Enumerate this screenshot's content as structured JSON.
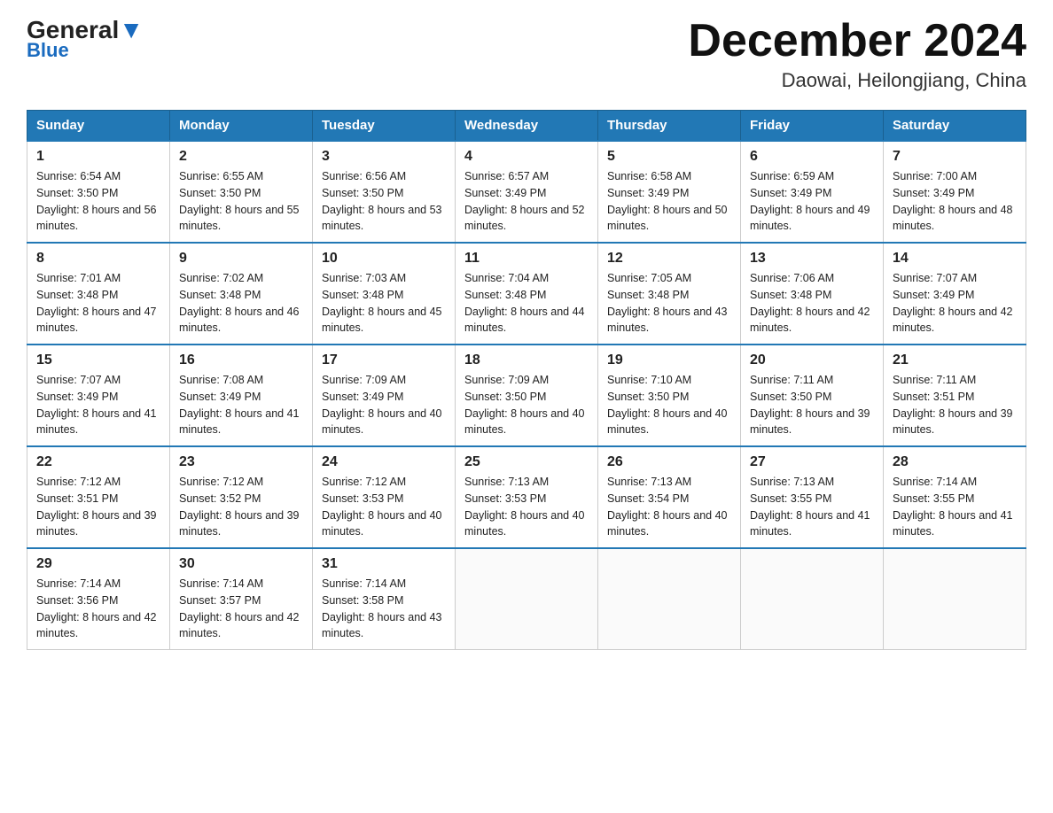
{
  "header": {
    "logo_general": "General",
    "logo_blue": "Blue",
    "month_year": "December 2024",
    "location": "Daowai, Heilongjiang, China"
  },
  "days_of_week": [
    "Sunday",
    "Monday",
    "Tuesday",
    "Wednesday",
    "Thursday",
    "Friday",
    "Saturday"
  ],
  "weeks": [
    [
      {
        "day": "1",
        "sunrise": "6:54 AM",
        "sunset": "3:50 PM",
        "daylight": "8 hours and 56 minutes."
      },
      {
        "day": "2",
        "sunrise": "6:55 AM",
        "sunset": "3:50 PM",
        "daylight": "8 hours and 55 minutes."
      },
      {
        "day": "3",
        "sunrise": "6:56 AM",
        "sunset": "3:50 PM",
        "daylight": "8 hours and 53 minutes."
      },
      {
        "day": "4",
        "sunrise": "6:57 AM",
        "sunset": "3:49 PM",
        "daylight": "8 hours and 52 minutes."
      },
      {
        "day": "5",
        "sunrise": "6:58 AM",
        "sunset": "3:49 PM",
        "daylight": "8 hours and 50 minutes."
      },
      {
        "day": "6",
        "sunrise": "6:59 AM",
        "sunset": "3:49 PM",
        "daylight": "8 hours and 49 minutes."
      },
      {
        "day": "7",
        "sunrise": "7:00 AM",
        "sunset": "3:49 PM",
        "daylight": "8 hours and 48 minutes."
      }
    ],
    [
      {
        "day": "8",
        "sunrise": "7:01 AM",
        "sunset": "3:48 PM",
        "daylight": "8 hours and 47 minutes."
      },
      {
        "day": "9",
        "sunrise": "7:02 AM",
        "sunset": "3:48 PM",
        "daylight": "8 hours and 46 minutes."
      },
      {
        "day": "10",
        "sunrise": "7:03 AM",
        "sunset": "3:48 PM",
        "daylight": "8 hours and 45 minutes."
      },
      {
        "day": "11",
        "sunrise": "7:04 AM",
        "sunset": "3:48 PM",
        "daylight": "8 hours and 44 minutes."
      },
      {
        "day": "12",
        "sunrise": "7:05 AM",
        "sunset": "3:48 PM",
        "daylight": "8 hours and 43 minutes."
      },
      {
        "day": "13",
        "sunrise": "7:06 AM",
        "sunset": "3:48 PM",
        "daylight": "8 hours and 42 minutes."
      },
      {
        "day": "14",
        "sunrise": "7:07 AM",
        "sunset": "3:49 PM",
        "daylight": "8 hours and 42 minutes."
      }
    ],
    [
      {
        "day": "15",
        "sunrise": "7:07 AM",
        "sunset": "3:49 PM",
        "daylight": "8 hours and 41 minutes."
      },
      {
        "day": "16",
        "sunrise": "7:08 AM",
        "sunset": "3:49 PM",
        "daylight": "8 hours and 41 minutes."
      },
      {
        "day": "17",
        "sunrise": "7:09 AM",
        "sunset": "3:49 PM",
        "daylight": "8 hours and 40 minutes."
      },
      {
        "day": "18",
        "sunrise": "7:09 AM",
        "sunset": "3:50 PM",
        "daylight": "8 hours and 40 minutes."
      },
      {
        "day": "19",
        "sunrise": "7:10 AM",
        "sunset": "3:50 PM",
        "daylight": "8 hours and 40 minutes."
      },
      {
        "day": "20",
        "sunrise": "7:11 AM",
        "sunset": "3:50 PM",
        "daylight": "8 hours and 39 minutes."
      },
      {
        "day": "21",
        "sunrise": "7:11 AM",
        "sunset": "3:51 PM",
        "daylight": "8 hours and 39 minutes."
      }
    ],
    [
      {
        "day": "22",
        "sunrise": "7:12 AM",
        "sunset": "3:51 PM",
        "daylight": "8 hours and 39 minutes."
      },
      {
        "day": "23",
        "sunrise": "7:12 AM",
        "sunset": "3:52 PM",
        "daylight": "8 hours and 39 minutes."
      },
      {
        "day": "24",
        "sunrise": "7:12 AM",
        "sunset": "3:53 PM",
        "daylight": "8 hours and 40 minutes."
      },
      {
        "day": "25",
        "sunrise": "7:13 AM",
        "sunset": "3:53 PM",
        "daylight": "8 hours and 40 minutes."
      },
      {
        "day": "26",
        "sunrise": "7:13 AM",
        "sunset": "3:54 PM",
        "daylight": "8 hours and 40 minutes."
      },
      {
        "day": "27",
        "sunrise": "7:13 AM",
        "sunset": "3:55 PM",
        "daylight": "8 hours and 41 minutes."
      },
      {
        "day": "28",
        "sunrise": "7:14 AM",
        "sunset": "3:55 PM",
        "daylight": "8 hours and 41 minutes."
      }
    ],
    [
      {
        "day": "29",
        "sunrise": "7:14 AM",
        "sunset": "3:56 PM",
        "daylight": "8 hours and 42 minutes."
      },
      {
        "day": "30",
        "sunrise": "7:14 AM",
        "sunset": "3:57 PM",
        "daylight": "8 hours and 42 minutes."
      },
      {
        "day": "31",
        "sunrise": "7:14 AM",
        "sunset": "3:58 PM",
        "daylight": "8 hours and 43 minutes."
      },
      null,
      null,
      null,
      null
    ]
  ]
}
